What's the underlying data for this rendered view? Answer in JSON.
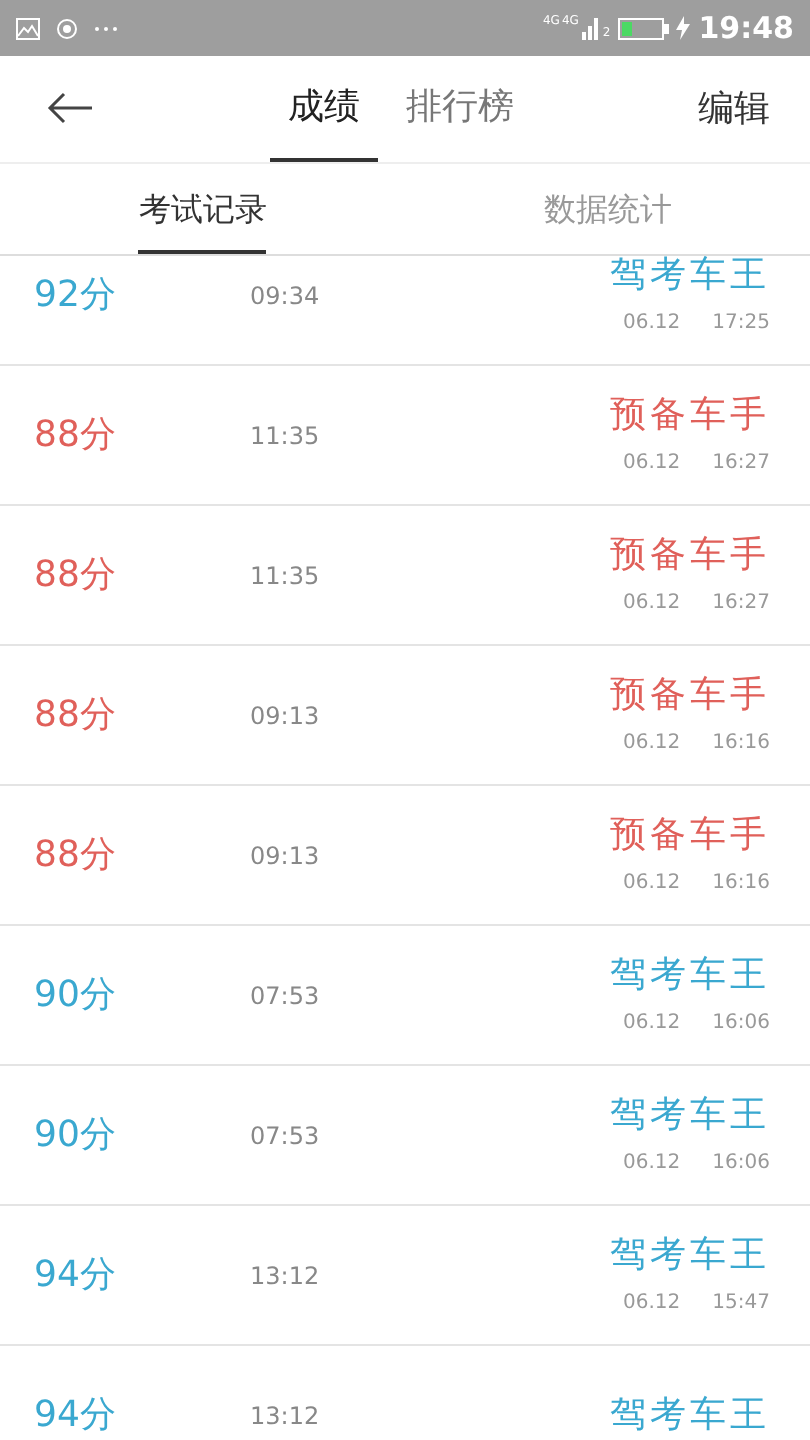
{
  "status_bar": {
    "network_labels": [
      "4G",
      "4G"
    ],
    "sim_slot": "2",
    "time": "19:48"
  },
  "header": {
    "tabs": [
      {
        "label": "成绩",
        "selected": true
      },
      {
        "label": "排行榜",
        "selected": false
      }
    ],
    "action": "编辑"
  },
  "sub_tabs": [
    {
      "label": "考试记录",
      "selected": true
    },
    {
      "label": "数据统计",
      "selected": false
    }
  ],
  "records": [
    {
      "score": "92分",
      "duration": "09:34",
      "title": "驾考车王",
      "date": "06.12",
      "time": "17:25",
      "color": "#3aa8d0"
    },
    {
      "score": "88分",
      "duration": "11:35",
      "title": "预备车手",
      "date": "06.12",
      "time": "16:27",
      "color": "#e0605a"
    },
    {
      "score": "88分",
      "duration": "11:35",
      "title": "预备车手",
      "date": "06.12",
      "time": "16:27",
      "color": "#e0605a"
    },
    {
      "score": "88分",
      "duration": "09:13",
      "title": "预备车手",
      "date": "06.12",
      "time": "16:16",
      "color": "#e0605a"
    },
    {
      "score": "88分",
      "duration": "09:13",
      "title": "预备车手",
      "date": "06.12",
      "time": "16:16",
      "color": "#e0605a"
    },
    {
      "score": "90分",
      "duration": "07:53",
      "title": "驾考车王",
      "date": "06.12",
      "time": "16:06",
      "color": "#3aa8d0"
    },
    {
      "score": "90分",
      "duration": "07:53",
      "title": "驾考车王",
      "date": "06.12",
      "time": "16:06",
      "color": "#3aa8d0"
    },
    {
      "score": "94分",
      "duration": "13:12",
      "title": "驾考车王",
      "date": "06.12",
      "time": "15:47",
      "color": "#3aa8d0"
    },
    {
      "score": "94分",
      "duration": "13:12",
      "title": "驾考车王",
      "color": "#3aa8d0"
    }
  ]
}
